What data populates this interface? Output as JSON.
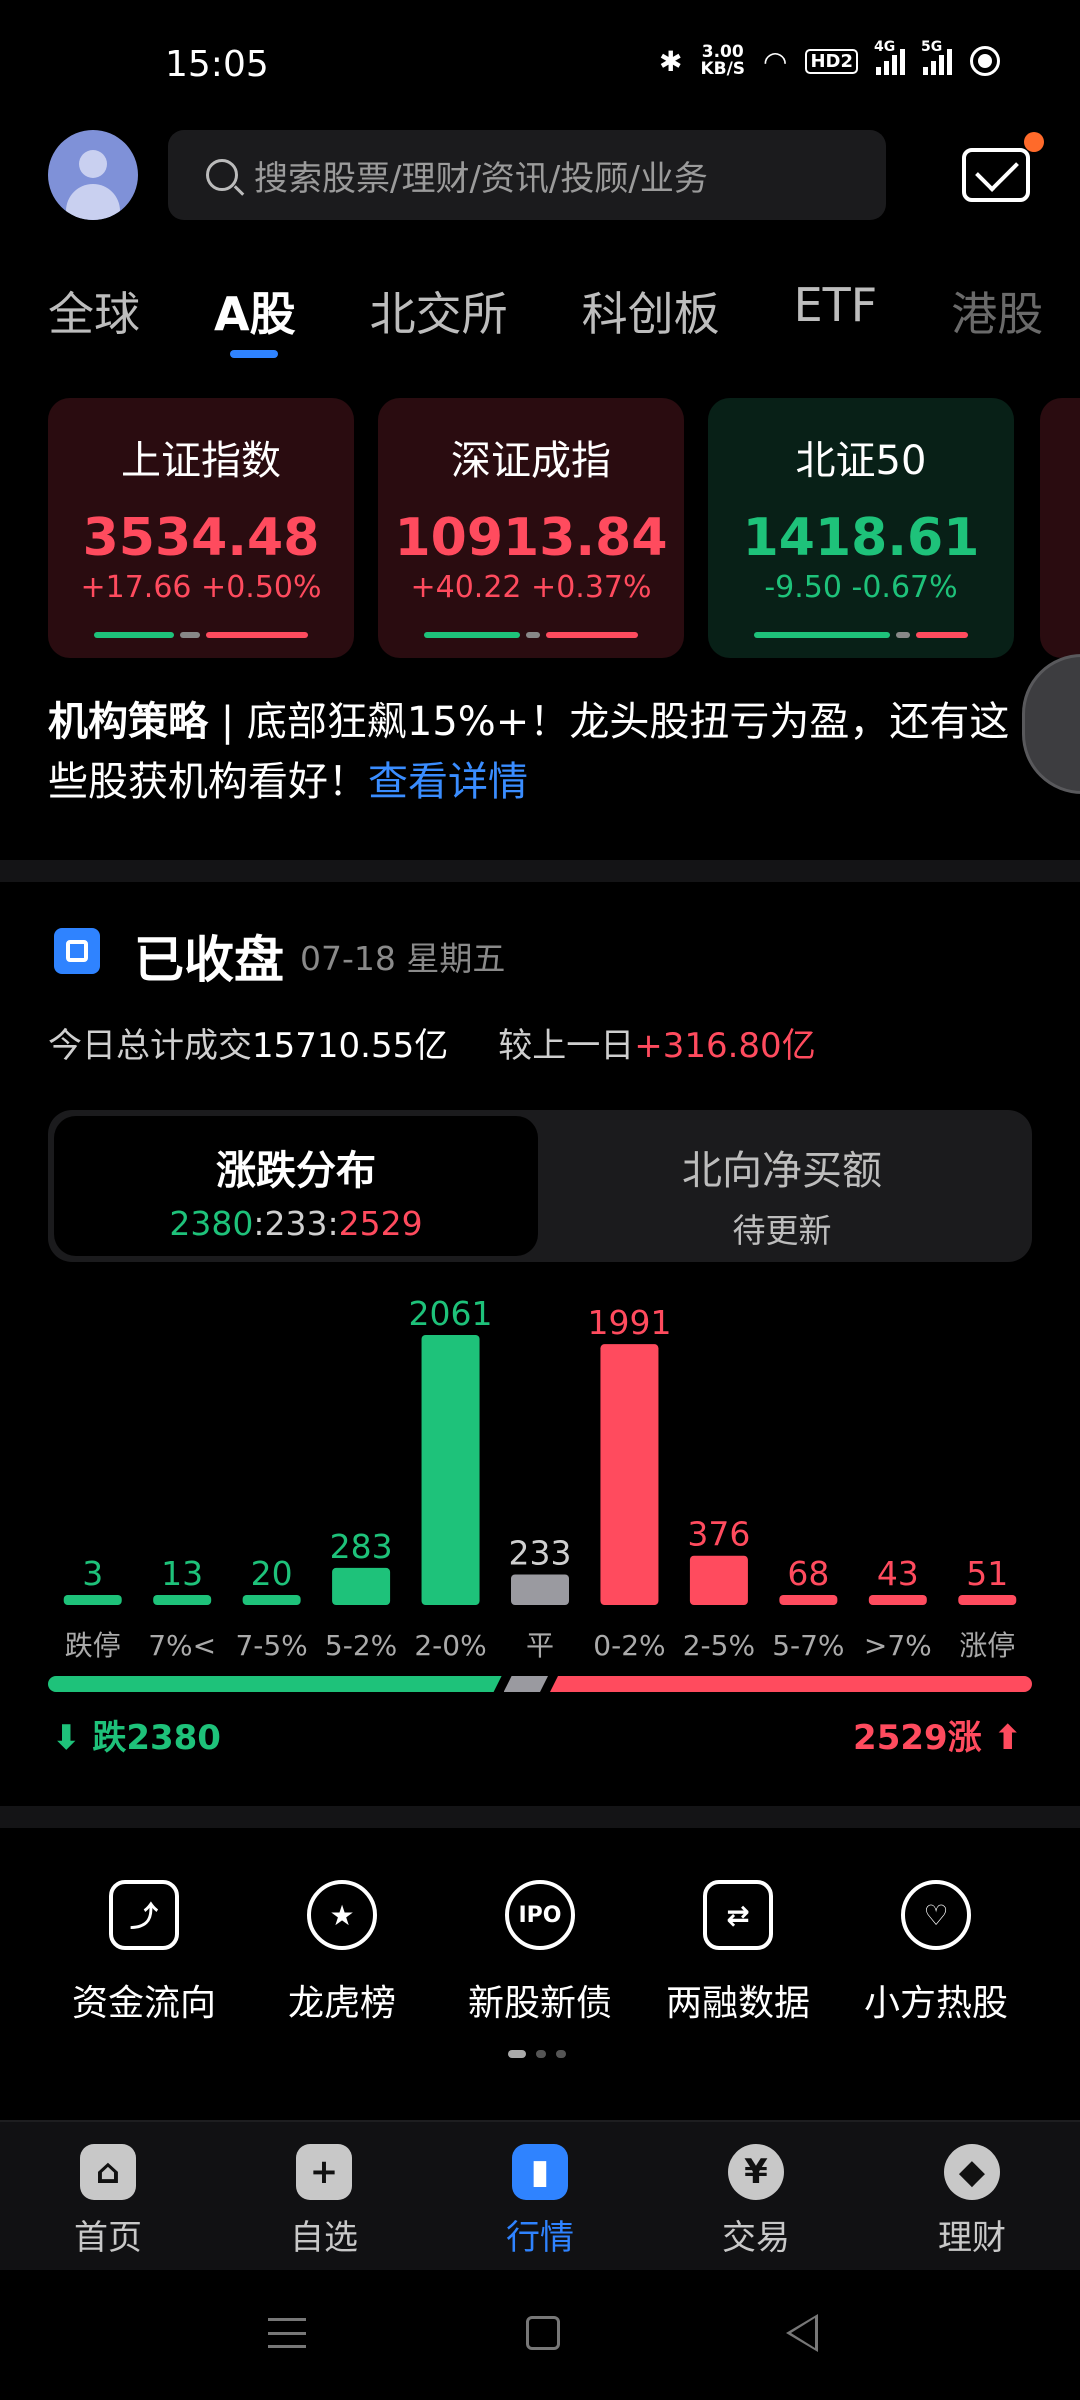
{
  "status_bar": {
    "time": "15:05",
    "speed_value": "3.00",
    "speed_unit": "KB/S",
    "hd_label": "HD2",
    "net1": "4G",
    "net2": "5G"
  },
  "header": {
    "search_placeholder": "搜索股票/理财/资讯/投顾/业务",
    "has_unread": true
  },
  "tabs": [
    "全球",
    "A股",
    "北交所",
    "科创板",
    "ETF",
    "港股"
  ],
  "active_tab": "A股",
  "indices": [
    {
      "name": "上证指数",
      "value": "3534.48",
      "change": "+17.66 +0.50%",
      "trend": "up"
    },
    {
      "name": "深证成指",
      "value": "10913.84",
      "change": "+40.22 +0.37%",
      "trend": "up"
    },
    {
      "name": "北证50",
      "value": "1418.61",
      "change": "-9.50 -0.67%",
      "trend": "down"
    }
  ],
  "news": {
    "tag": "机构策略",
    "sep": " | ",
    "text": "底部狂飙15%+！龙头股扭亏为盈，还有这些股获机构看好！",
    "link": "查看详情"
  },
  "market": {
    "status": "已收盘",
    "date": "07-18 星期五",
    "volume_label": "今日总计成交",
    "volume_value": "15710.55亿",
    "compare_label": "较上一日",
    "compare_value": "+316.80亿"
  },
  "segment": {
    "left_title": "涨跌分布",
    "down": "2380",
    "sep1": ":",
    "flat": "233",
    "sep2": ":",
    "up": "2529",
    "right_title": "北向净买额",
    "right_sub": "待更新"
  },
  "chart_data": {
    "type": "bar",
    "categories": [
      "跌停",
      "7%<",
      "7-5%",
      "5-2%",
      "2-0%",
      "平",
      "0-2%",
      "2-5%",
      "5-7%",
      ">7%",
      "涨停"
    ],
    "values": [
      3,
      13,
      20,
      283,
      2061,
      233,
      1991,
      376,
      68,
      43,
      51
    ],
    "groups": [
      "down",
      "down",
      "down",
      "down",
      "down",
      "flat",
      "up",
      "up",
      "up",
      "up",
      "up"
    ],
    "title": "",
    "xlabel": "",
    "ylabel": "",
    "colors": {
      "down": "#1ec27a",
      "flat": "#9a9aa0",
      "up": "#ff4b5e"
    }
  },
  "totals": {
    "down_label": "⬇ 跌2380",
    "up_label": "2529涨 ⬆",
    "down": 2380,
    "flat": 233,
    "up": 2529
  },
  "tools": [
    {
      "label": "资金流向",
      "icon": "fund-flow-icon",
      "glyph": "⤴"
    },
    {
      "label": "龙虎榜",
      "icon": "dragon-tiger-icon",
      "glyph": "★"
    },
    {
      "label": "新股新债",
      "icon": "ipo-icon",
      "glyph": "IPO"
    },
    {
      "label": "两融数据",
      "icon": "margin-data-icon",
      "glyph": "⇄"
    },
    {
      "label": "小方热股",
      "icon": "hot-stock-icon",
      "glyph": "♡"
    }
  ],
  "bottom_nav": [
    {
      "label": "首页",
      "glyph": "⌂"
    },
    {
      "label": "自选",
      "glyph": "+"
    },
    {
      "label": "行情",
      "glyph": "▮"
    },
    {
      "label": "交易",
      "glyph": "¥"
    },
    {
      "label": "理财",
      "glyph": "◆"
    }
  ],
  "active_nav": "行情",
  "colors": {
    "up": "#ff4b5e",
    "down": "#1ec27a",
    "accent": "#2f83ff",
    "background": "#000000"
  }
}
